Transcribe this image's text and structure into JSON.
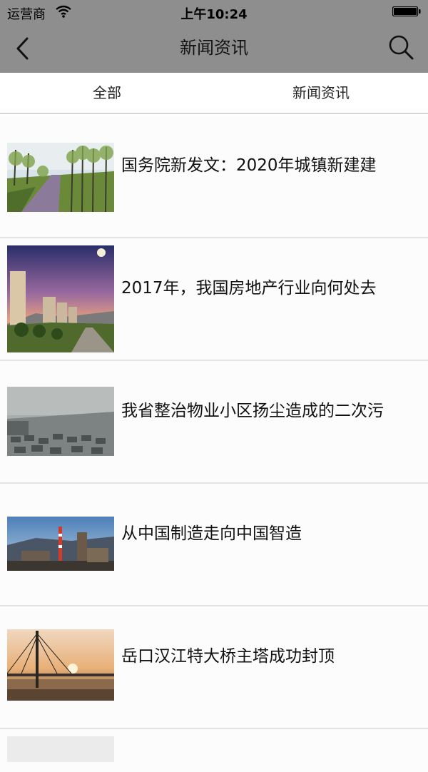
{
  "status_bar": {
    "carrier": "运营商",
    "time": "上午10:24"
  },
  "nav": {
    "title": "新闻资讯"
  },
  "tabs": [
    {
      "label": "全部"
    },
    {
      "label": "新闻资讯"
    }
  ],
  "news": [
    {
      "title": "国务院新发文：2020年城镇新建建",
      "image": "tree-lined-road-photo"
    },
    {
      "title": "2017年，我国房地产行业向何处去",
      "image": "residential-towers-dusk-photo"
    },
    {
      "title": "我省整治物业小区扬尘造成的二次污",
      "image": "smoggy-traffic-photo"
    },
    {
      "title": "从中国制造走向中国智造",
      "image": "industrial-plant-photo"
    },
    {
      "title": "岳口汉江特大桥主塔成功封顶",
      "image": "bridge-sunset-photo"
    }
  ]
}
